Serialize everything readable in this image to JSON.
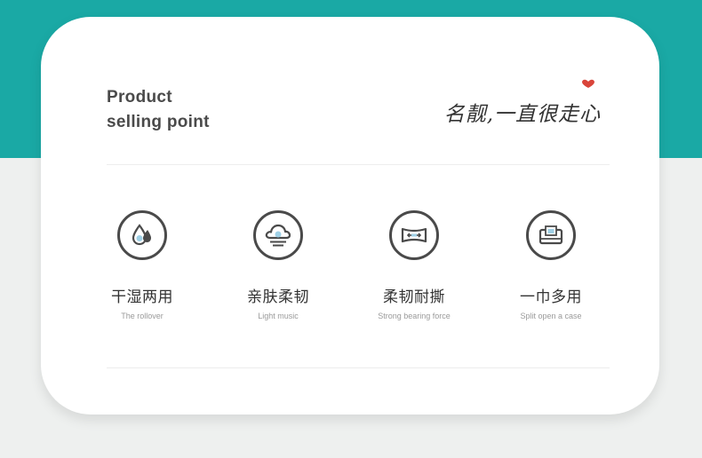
{
  "header": {
    "line1": "Product",
    "line2": "selling point",
    "slogan": "名靓,一直很走心"
  },
  "colors": {
    "teal": "#1aa9a5",
    "accent_red": "#d9453a",
    "icon_blue": "#9fd0e6",
    "text_dark": "#333333",
    "text_muted": "#9a9a9a"
  },
  "features": [
    {
      "icon": "water-drop-icon",
      "title": "干湿两用",
      "subtitle": "The rollover"
    },
    {
      "icon": "cloud-icon",
      "title": "亲肤柔韧",
      "subtitle": "Light music"
    },
    {
      "icon": "stretch-cloth-icon",
      "title": "柔韧耐撕",
      "subtitle": "Strong bearing force"
    },
    {
      "icon": "tissue-box-icon",
      "title": "一巾多用",
      "subtitle": "Split open a case"
    }
  ]
}
